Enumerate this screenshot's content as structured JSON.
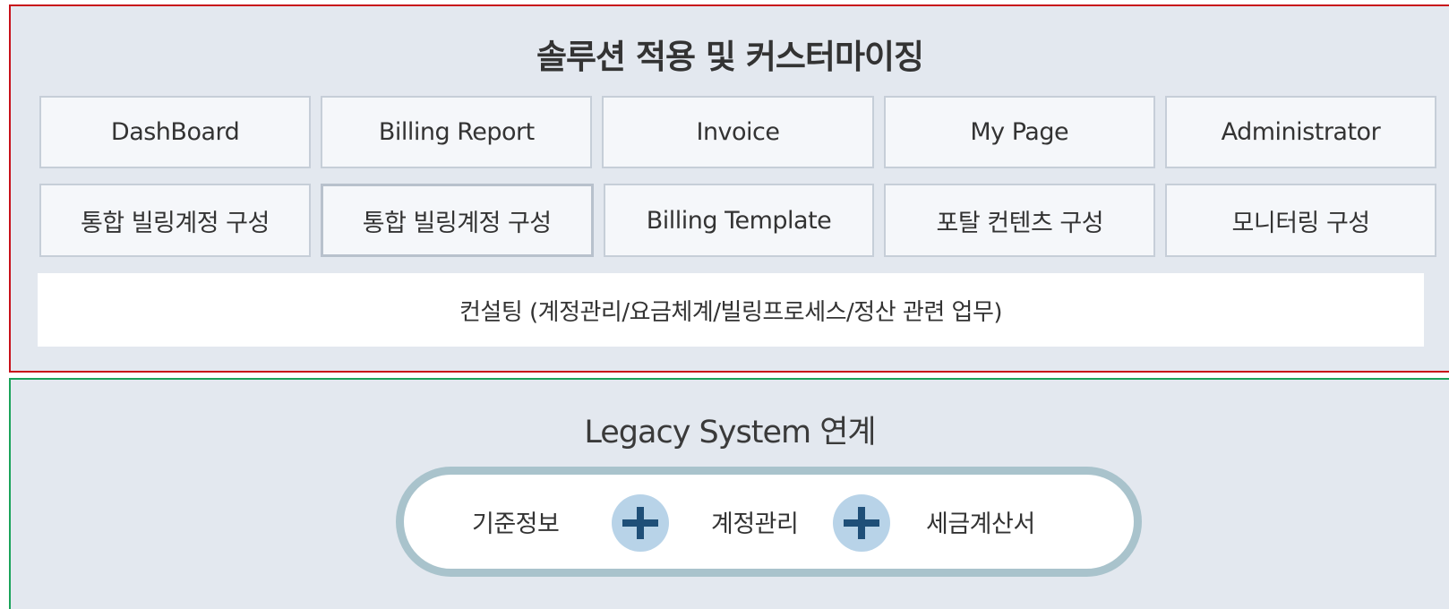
{
  "solution_panel": {
    "title": "솔루션 적용 및 커스터마이징",
    "row1": [
      "DashBoard",
      "Billing Report",
      "Invoice",
      "My Page",
      "Administrator"
    ],
    "row2": [
      "통합 빌링계정 구성",
      "통합 빌링계정 구성",
      "Billing Template",
      "포탈 컨텐츠 구성",
      "모니터링 구성"
    ],
    "consulting": "컨설팅 (계정관리/요금체계/빌링프로세스/정산 관련 업무)"
  },
  "legacy_panel": {
    "title": "Legacy System 연계",
    "items": [
      "기준정보",
      "계정관리",
      "세금계산서"
    ],
    "connector_icon": "plus-icon"
  },
  "colors": {
    "solution_border": "#c8111a",
    "legacy_border": "#1aa35a",
    "panel_bg": "#e3e8ef",
    "pill_border": "#a9c3cc",
    "plus_circle": "#b8d3e8",
    "plus_sign": "#1f4f78"
  }
}
